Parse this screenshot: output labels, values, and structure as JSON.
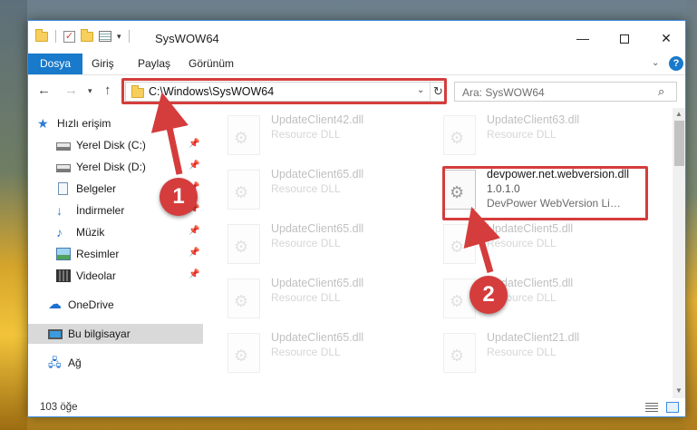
{
  "title_bar": {
    "title": "SysWOW64",
    "controls": {
      "minimize": "—",
      "maximize": "",
      "close": "✕"
    }
  },
  "ribbon": {
    "tabs": [
      "Dosya",
      "Giriş",
      "Paylaş",
      "Görünüm"
    ],
    "help": "?"
  },
  "address": {
    "path": "C:\\Windows\\SysWOW64"
  },
  "search": {
    "placeholder": "Ara: SysWOW64"
  },
  "sidebar": {
    "items": [
      {
        "label": "Hızlı erişim",
        "icon": "star-icon"
      },
      {
        "label": "Yerel Disk (C:)",
        "icon": "drive-icon",
        "pinned": true
      },
      {
        "label": "Yerel Disk (D:)",
        "icon": "drive-icon",
        "pinned": true
      },
      {
        "label": "Belgeler",
        "icon": "documents-icon",
        "pinned": true
      },
      {
        "label": "İndirmeler",
        "icon": "downloads-icon",
        "pinned": true
      },
      {
        "label": "Müzik",
        "icon": "music-icon",
        "pinned": true
      },
      {
        "label": "Resimler",
        "icon": "pictures-icon",
        "pinned": true
      },
      {
        "label": "Videolar",
        "icon": "videos-icon",
        "pinned": true
      },
      {
        "label": "OneDrive",
        "icon": "onedrive-icon"
      },
      {
        "label": "Bu bilgisayar",
        "icon": "this-pc-icon",
        "selected": true
      },
      {
        "label": "Ağ",
        "icon": "network-icon"
      }
    ]
  },
  "files": [
    {
      "name": "UpdateClient42.dll",
      "desc": "Resource DLL"
    },
    {
      "name": "UpdateClient63.dll",
      "desc": "Resource DLL"
    },
    {
      "name": "UpdateClient65.dll",
      "desc": "Resource DLL"
    },
    {
      "name": "devpower.net.webversion.dll",
      "version": "1.0.1.0",
      "desc": "DevPower WebVersion Library"
    },
    {
      "name": "UpdateClient65.dll",
      "desc": "Resource DLL"
    },
    {
      "name": "UpdateClient5.dll",
      "desc": "Resource DLL"
    },
    {
      "name": "UpdateClient65.dll",
      "desc": "Resource DLL"
    },
    {
      "name": "UpdateClient5.dll",
      "desc": "Resource DLL"
    },
    {
      "name": "UpdateClient65.dll",
      "desc": "Resource DLL"
    },
    {
      "name": "UpdateClient21.dll",
      "desc": "Resource DLL"
    }
  ],
  "status": {
    "count": "103 öğe"
  },
  "callouts": {
    "step1": "1",
    "step2": "2",
    "color": "#d53c3c"
  }
}
